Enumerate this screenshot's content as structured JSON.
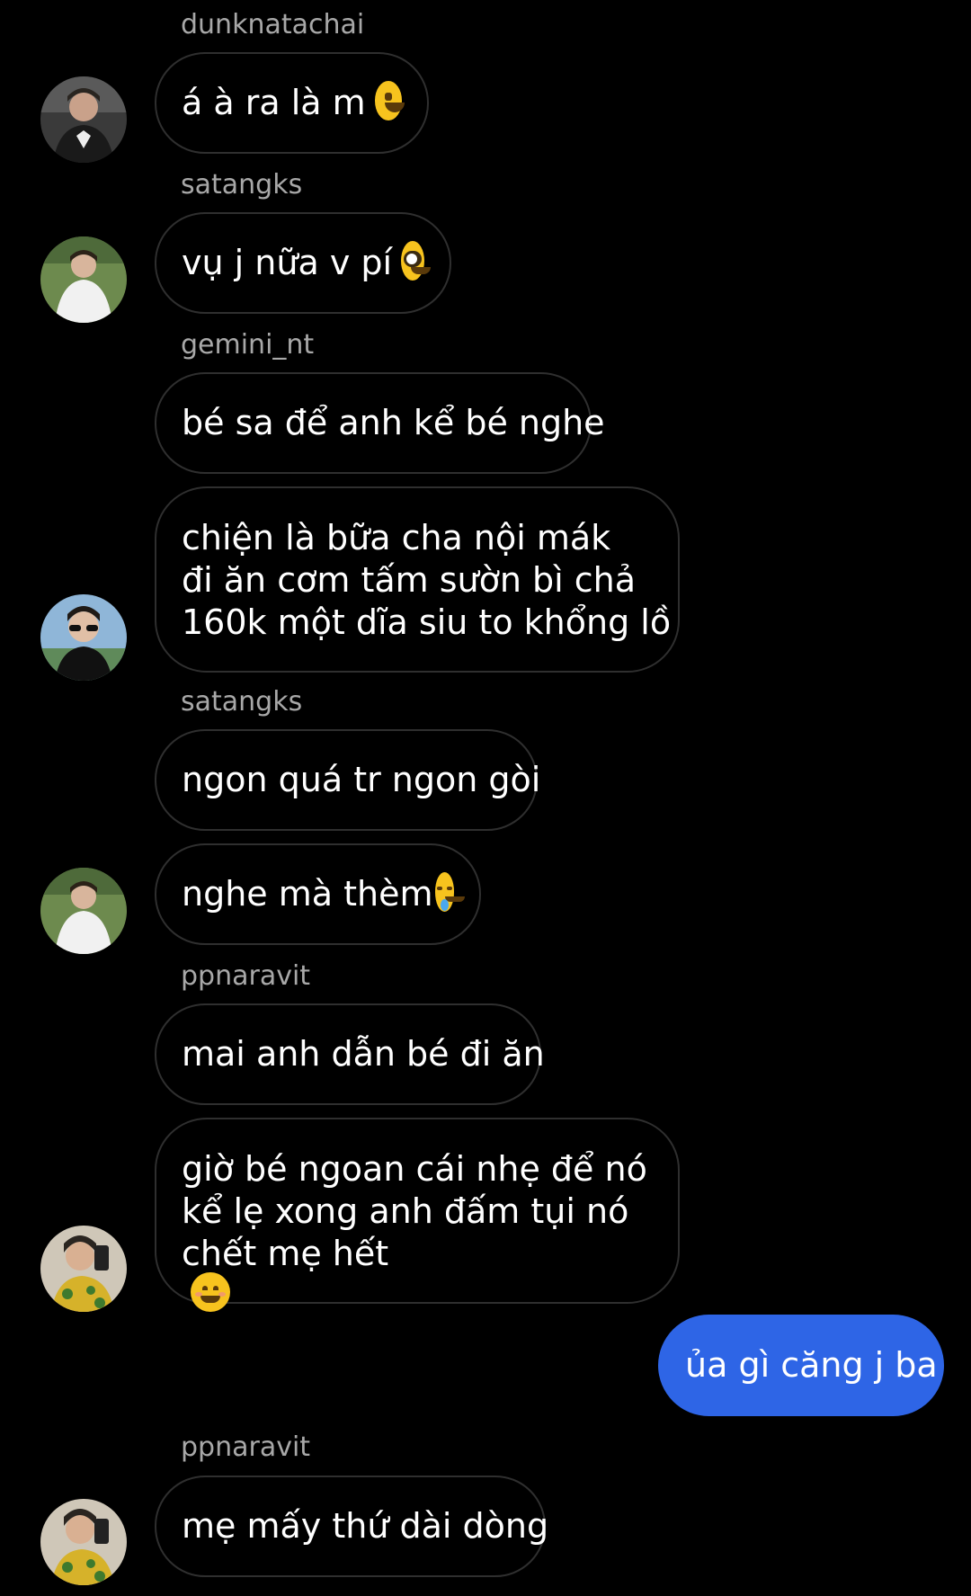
{
  "messages": {
    "m1": {
      "sender": "dunknatachai",
      "text": "á à ra là m",
      "emoji": "grinning-face-emoji"
    },
    "m2": {
      "sender": "satangks",
      "text": "vụ j nữa v pí",
      "emoji": "nerd-face-emoji"
    },
    "m3": {
      "sender": "gemini_nt",
      "text": "bé sa để anh kể bé nghe"
    },
    "m4": {
      "lines": [
        "chiện là bữa cha nội mák",
        "đi ăn cơm tấm sườn bì chả",
        "160k một dĩa siu to khổng lồ"
      ]
    },
    "m5": {
      "sender": "satangks",
      "text": "ngon quá tr ngon gòi"
    },
    "m6": {
      "text": "nghe mà thèm",
      "emoji": "drooling-face-emoji"
    },
    "m7": {
      "sender": "ppnaravit",
      "text": "mai anh dẫn bé đi ăn"
    },
    "m8": {
      "lines": [
        "giờ bé ngoan cái nhẹ để nó",
        "kể lẹ xong anh đấm tụi nó",
        "chết mẹ hết"
      ],
      "emoji": "smiling-face-emoji"
    },
    "m9": {
      "text": "ủa gì căng j ba",
      "mine": true
    },
    "m10": {
      "sender": "ppnaravit",
      "text": "mẹ mấy thứ dài dòng"
    }
  },
  "colors": {
    "background": "#000000",
    "bubble_border": "#2f2f2f",
    "mine_bubble": "#2e65e6",
    "sender_name": "#a8a8a8"
  }
}
